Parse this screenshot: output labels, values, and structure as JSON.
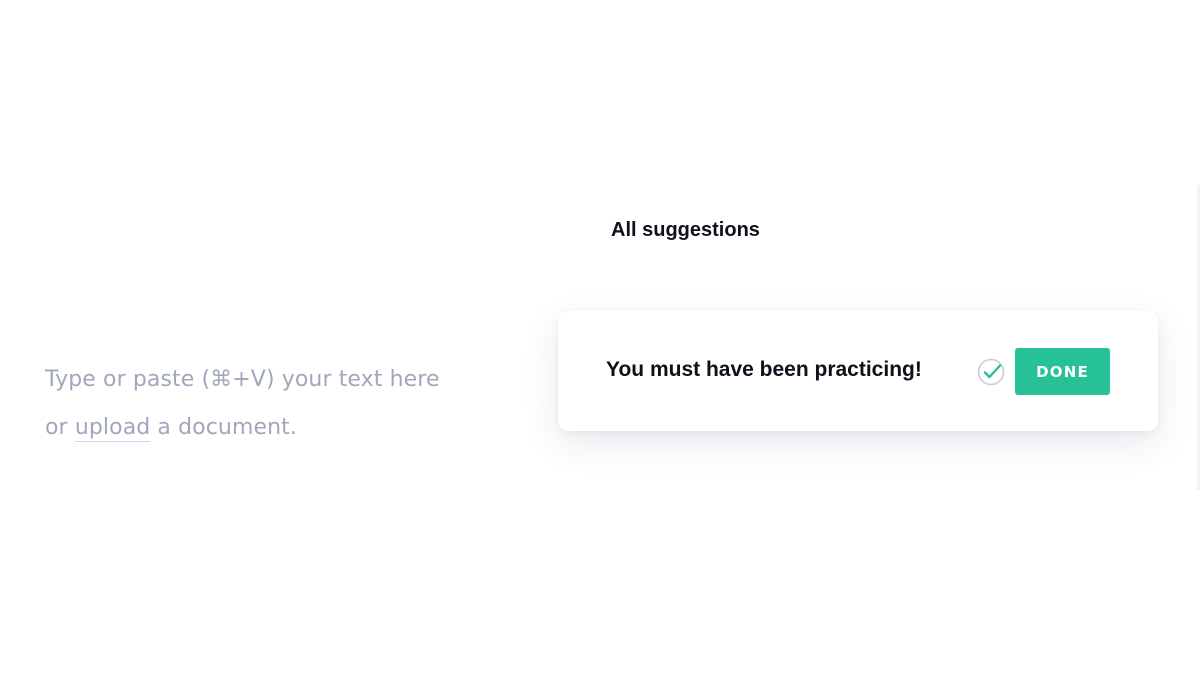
{
  "editor": {
    "placeholder_line1": "Type or paste (⌘+V) your text here",
    "placeholder_or": "or ",
    "upload_link": "upload",
    "placeholder_tail": " a document."
  },
  "suggestions_panel": {
    "title": "All suggestions",
    "card": {
      "message": "You must have been practicing!",
      "done_label": "DONE",
      "icon": "check-circle-icon"
    }
  },
  "colors": {
    "accent": "#27c197",
    "placeholder_text": "#a1a7bd",
    "heading_text": "#0e101a"
  }
}
